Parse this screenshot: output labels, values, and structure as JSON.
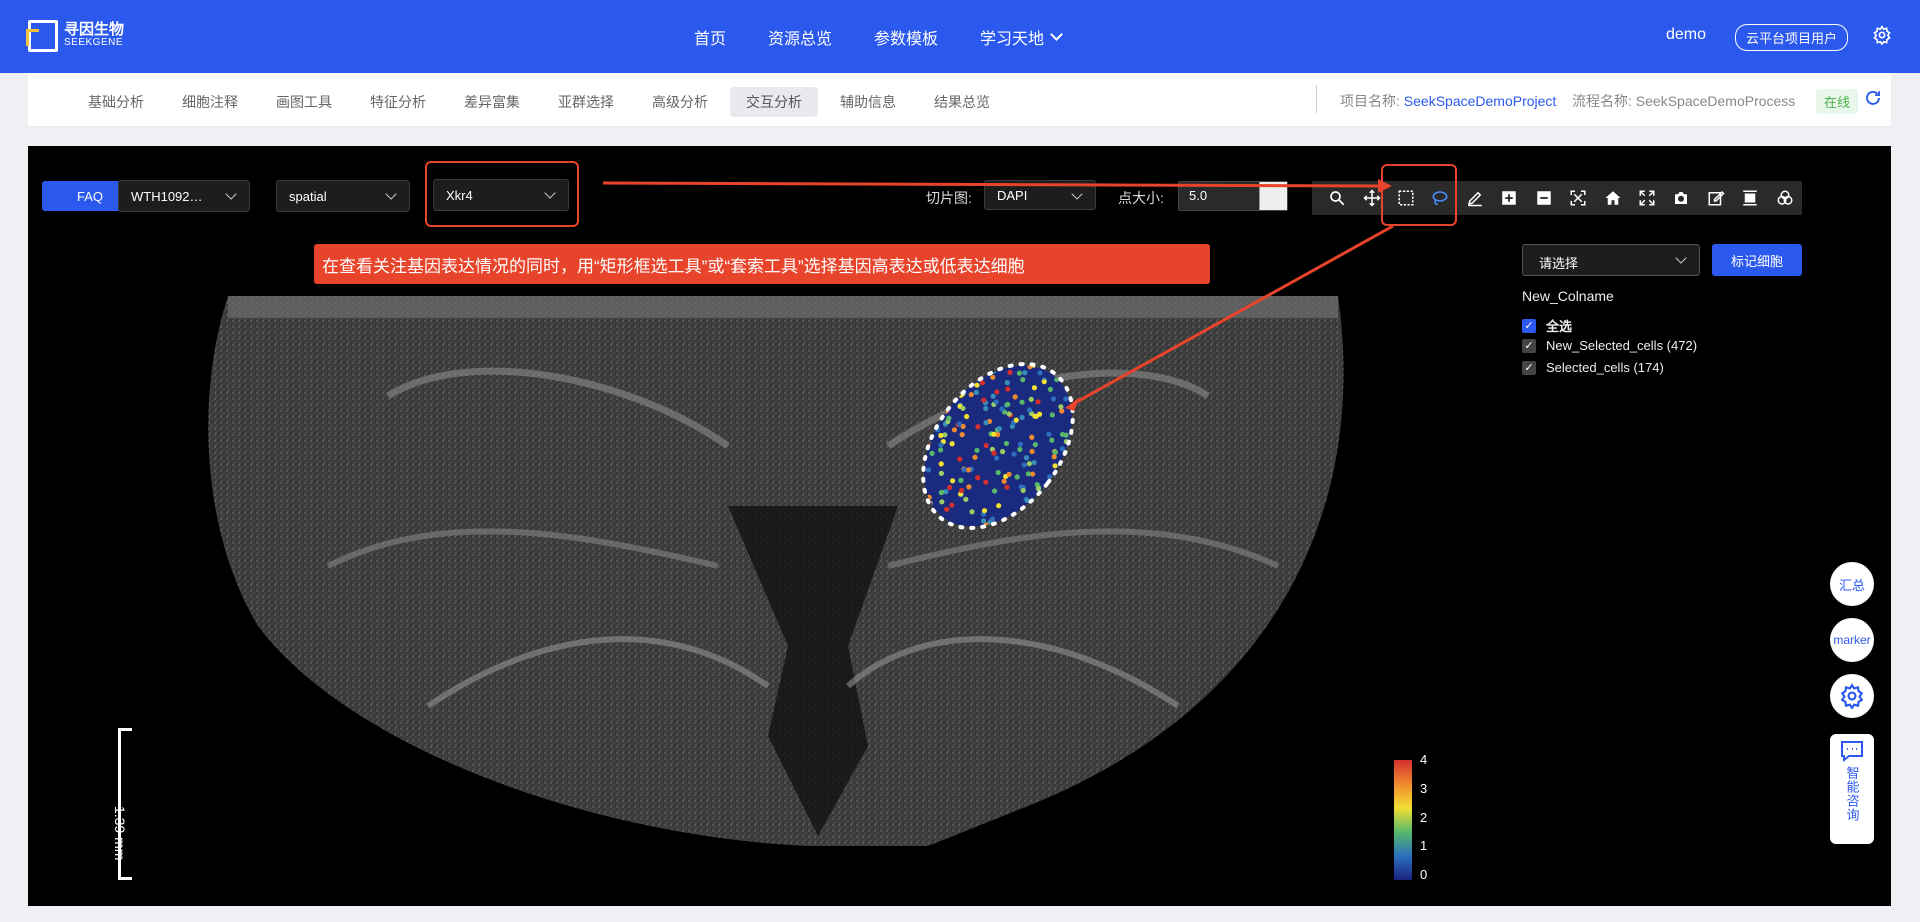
{
  "brand": {
    "cn": "寻因生物",
    "en": "SEEKGENE"
  },
  "nav": {
    "items": [
      {
        "label": "首页"
      },
      {
        "label": "资源总览"
      },
      {
        "label": "参数模板"
      },
      {
        "label": "学习天地"
      }
    ]
  },
  "header": {
    "user": "demo",
    "role": "云平台项目用户"
  },
  "tabs": [
    {
      "label": "基础分析"
    },
    {
      "label": "细胞注释"
    },
    {
      "label": "画图工具"
    },
    {
      "label": "特征分析"
    },
    {
      "label": "差异富集"
    },
    {
      "label": "亚群选择"
    },
    {
      "label": "高级分析"
    },
    {
      "label": "交互分析"
    },
    {
      "label": "辅助信息"
    },
    {
      "label": "结果总览"
    }
  ],
  "project": {
    "label": "项目名称:",
    "value": "SeekSpaceDemoProject",
    "flow_label": "流程名称:",
    "flow_value": "SeekSpaceDemoProcess",
    "status": "在线"
  },
  "controls": {
    "faq": "FAQ",
    "sample": "WTH1092…",
    "embedding": "spatial",
    "gene": "Xkr4",
    "slice_label": "切片图:",
    "slice_value": "DAPI",
    "point_label": "点大小:",
    "point_value": "5.0"
  },
  "annotation": "在查看关注基因表达情况的同时，用“矩形框选工具”或“套索工具”选择基因高表达或低表达细胞",
  "right_panel": {
    "select_placeholder": "请选择",
    "mark_button": "标记细胞",
    "col_name": "New_Colname",
    "items": [
      {
        "label": "全选",
        "checked": true
      },
      {
        "label": "New_Selected_cells (472)",
        "checked": true
      },
      {
        "label": "Selected_cells (174)",
        "checked": true
      }
    ]
  },
  "scale": "1.39 mm",
  "colorbar": {
    "ticks": [
      "4",
      "3",
      "2",
      "1",
      "0"
    ]
  },
  "floating": {
    "summary": "汇总",
    "marker": "marker",
    "chat": "智能咨询"
  },
  "colors": {
    "primary": "#2b59ee",
    "annotation": "#e8432b"
  }
}
